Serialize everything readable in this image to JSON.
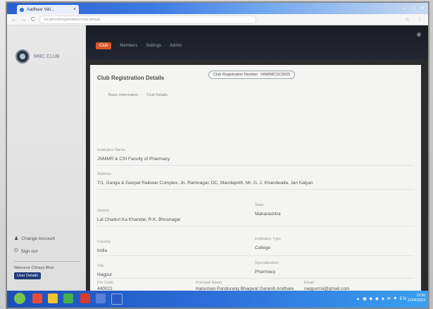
{
  "browser": {
    "tab_title": "Aadhaar Vali…",
    "tab_close": "×",
    "window_controls": [
      "–",
      "□",
      "×"
    ],
    "nav_glyphs": [
      "←",
      "→",
      "C"
    ],
    "url": "localhost/registration/club-details",
    "address_right_glyphs": [
      "☆",
      "⋮"
    ]
  },
  "sidebar": {
    "brand_name": "MRC CLUB",
    "items": [
      {
        "icon": "user-icon",
        "glyph": "♟",
        "label": "Change Account"
      },
      {
        "icon": "logout-icon",
        "glyph": "⏻",
        "label": "Sign out"
      }
    ],
    "footer_text": "Welcome Chhaya Bhat",
    "footer_button": "User Details"
  },
  "topnav": {
    "items": [
      {
        "label": "Club",
        "active": true
      },
      {
        "label": "Members",
        "active": false
      },
      {
        "label": "Settings",
        "active": false
      },
      {
        "label": "Admin",
        "active": false
      }
    ]
  },
  "card": {
    "title": "Club Registration Details",
    "chips": [
      "Club Registration Number",
      "HINRMCSC0025"
    ],
    "subtabs": [
      "Basic Information",
      "Club Details"
    ],
    "fields": {
      "institution_label": "Institution Name",
      "institution_value": "JNMMR & CSI Faculty of Pharmacy",
      "address_label": "Address",
      "address_value": "7/1, Ganga & Ganpat Raikwar Complex, Jn. Ramnagar, DC, Mandapeth, Mr. G. J. Khandwalla, Jan Kalyan",
      "district_label": "District",
      "district_value": "Lal Chaduri Ka Khandar, R.K. Bhosnagar",
      "state_label": "State",
      "state_value": "Maharashtra",
      "country_label": "Country",
      "country_value": "India",
      "institution_type_label": "Institution Type",
      "institution_type_value": "College",
      "city_label": "City",
      "city_value": "Nagpur",
      "specialization_label": "Specialization",
      "specialization_value": "Pharmacy",
      "pincode_label": "Pin Code",
      "pincode_value": "440021",
      "principal_label": "Principal Name",
      "principal_value": "Hanuman Pandurang Bhagwat Ganesh Andhare",
      "email_label": "Email",
      "email_value": "nagpurcsi@gmail.com"
    }
  },
  "taskbar": {
    "tray": "▲ ▣ ◆ ◉ ◈ ✉ ⚑ EN",
    "time": "12:56",
    "date": "12/06/2024"
  },
  "colors": {
    "nav_active": "#d8572a",
    "topnav_bg": "#1a1c24",
    "sidebar_bg": "#e4e4e4",
    "card_bg": "#f4f4f3",
    "taskbar": "#2d6fd9"
  }
}
